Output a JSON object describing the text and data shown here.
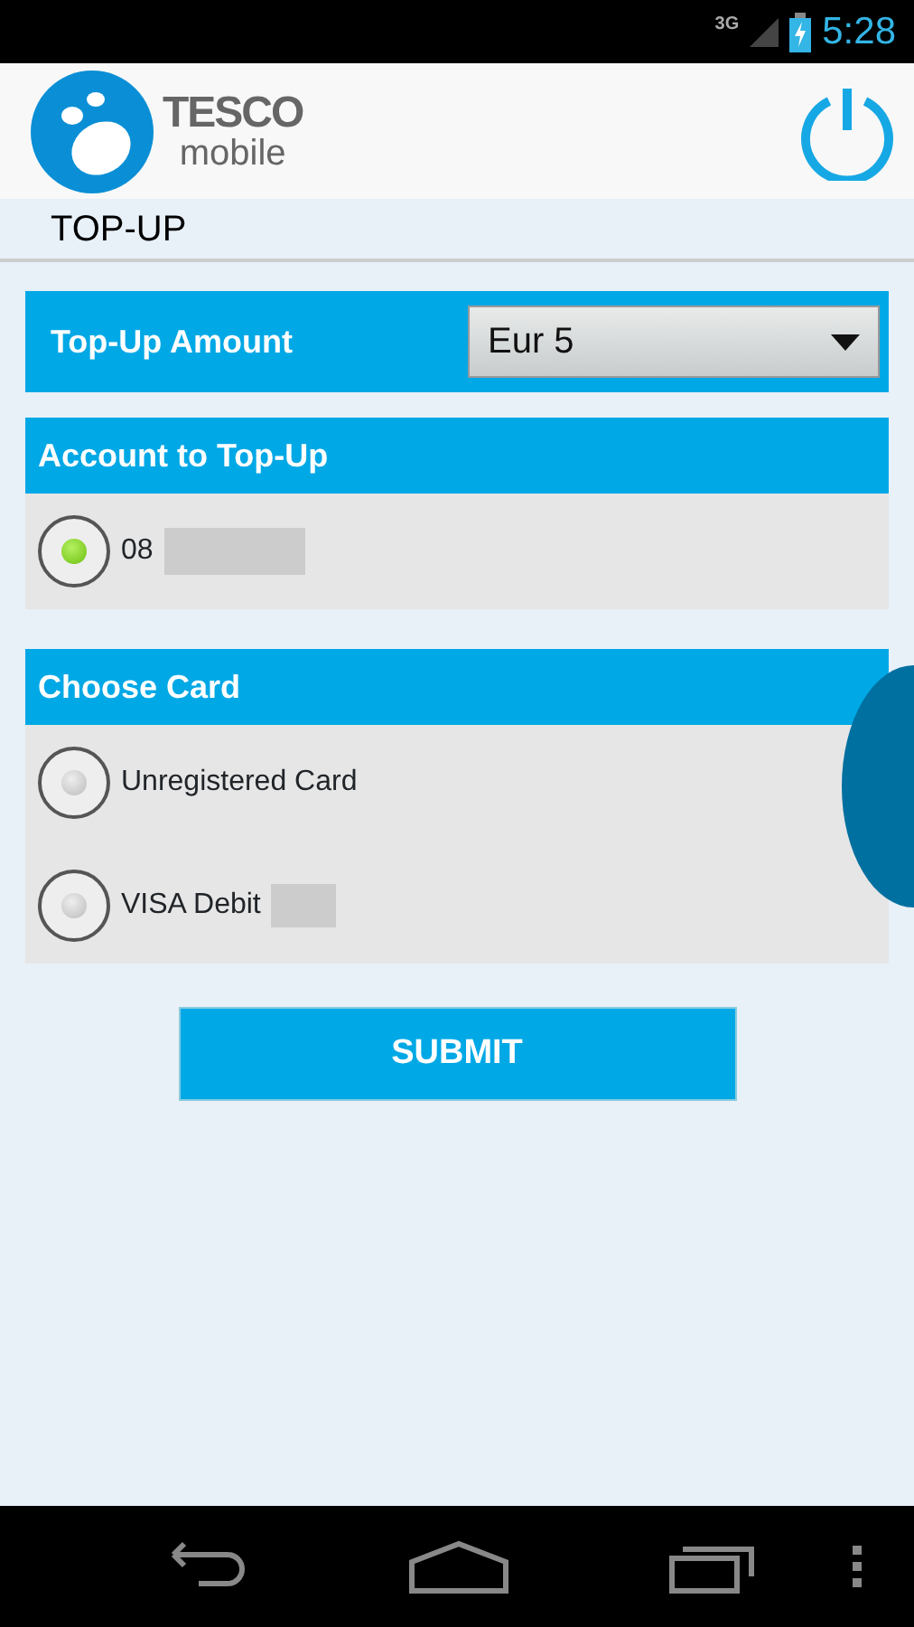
{
  "status_bar": {
    "network": "3G",
    "time": "5:28"
  },
  "header": {
    "logo_top": "TESCO",
    "logo_bottom": "mobile"
  },
  "page_title": "TOP-UP",
  "amount": {
    "label": "Top-Up Amount",
    "value": "Eur 5"
  },
  "account": {
    "title": "Account to Top-Up",
    "options": [
      {
        "label": "08",
        "selected": true,
        "redacted": true
      }
    ]
  },
  "card": {
    "title": "Choose Card",
    "options": [
      {
        "label": "Unregistered Card",
        "selected": false,
        "redacted": false
      },
      {
        "label": "VISA Debit",
        "selected": false,
        "redacted": true
      }
    ]
  },
  "submit": "SUBMIT"
}
